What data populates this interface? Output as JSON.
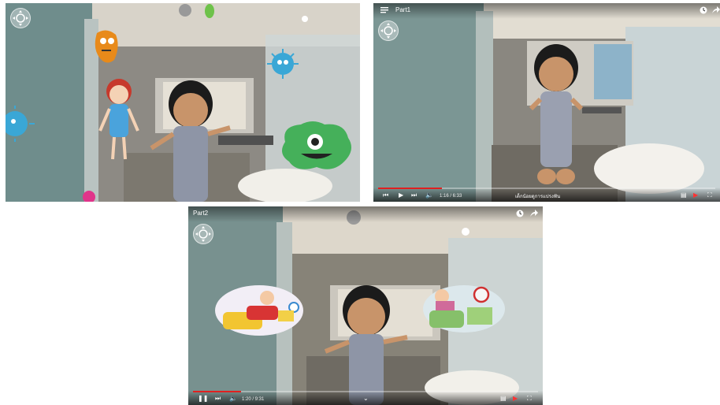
{
  "panels": [
    {
      "id": "panel-top-left"
    },
    {
      "id": "panel-top-right",
      "title": "Part1",
      "time": "1:16 / 6:33",
      "caption": "เด็กน้อยดูการแปรงฟัน",
      "progress": 0.19
    },
    {
      "id": "panel-bottom",
      "title": "Part2",
      "time": "1:20 / 9:31",
      "progress": 0.14
    }
  ],
  "icons": {
    "navigation": "360-nav-icon",
    "menu": "playlist-menu-icon",
    "clock": "watch-later-icon",
    "share": "share-arrow-icon",
    "play": "play-icon",
    "pause": "pause-icon",
    "prev": "previous-icon",
    "next": "next-icon",
    "volume": "volume-icon",
    "subtitles": "subtitles-icon",
    "youtube": "youtube-icon",
    "fullscreen": "fullscreen-icon"
  },
  "colors": {
    "progress": "#e02020",
    "germ_blue": "#3aa7d6",
    "germ_green": "#45b05a",
    "germ_orange": "#e88a1a",
    "germ_pink": "#e0348a"
  }
}
